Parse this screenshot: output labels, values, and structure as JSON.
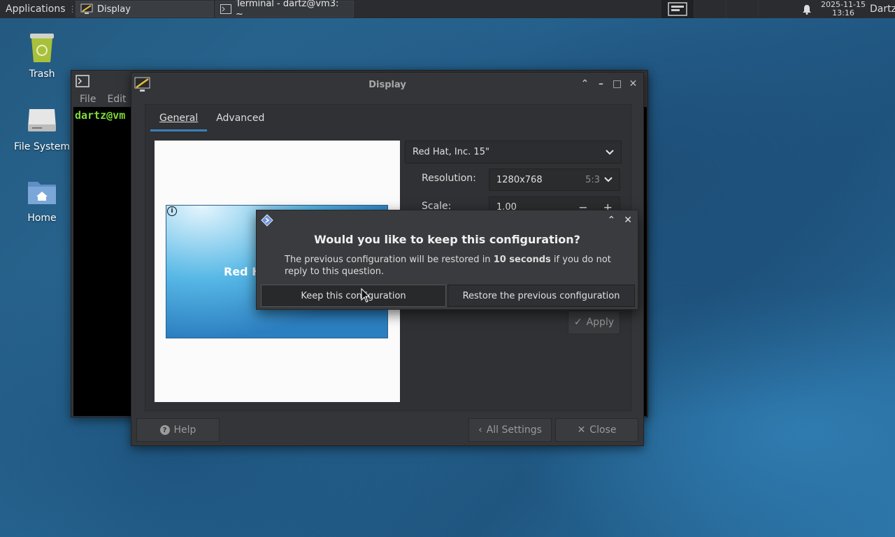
{
  "panel": {
    "applications_label": "Applications",
    "tasks": [
      {
        "label": "Display"
      },
      {
        "label": "Terminal - dartz@vm3: ~"
      }
    ],
    "date": "2025-11-15",
    "time": "13:16",
    "user": "Dartz"
  },
  "desktop": {
    "icons": [
      {
        "label": "Trash"
      },
      {
        "label": "File System"
      },
      {
        "label": "Home"
      }
    ]
  },
  "terminal": {
    "menu": [
      "File",
      "Edit"
    ],
    "prompt": "dartz@vm"
  },
  "display_window": {
    "title": "Display",
    "tabs": [
      "General",
      "Advanced"
    ],
    "monitor_select": "Red Hat, Inc. 15\"",
    "resolution_label": "Resolution:",
    "resolution_value": "1280x768",
    "aspect_ratio": "5:3",
    "scale_label": "Scale:",
    "scale_value": "1.00",
    "preview_label": "Red H",
    "apply_label": "Apply",
    "help_label": "Help",
    "all_settings_label": "All Settings",
    "close_label": "Close"
  },
  "dialog": {
    "heading": "Would you like to keep this configuration?",
    "body_pre": "The previous configuration will be restored in ",
    "body_bold": "10 seconds",
    "body_post": " if you do not reply to this question.",
    "keep_label": "Keep this configuration",
    "restore_label": "Restore the previous configuration"
  },
  "colors": {
    "accent": "#3d7fb8",
    "panel_bg": "#2a2c30",
    "window_bg": "#333538"
  }
}
